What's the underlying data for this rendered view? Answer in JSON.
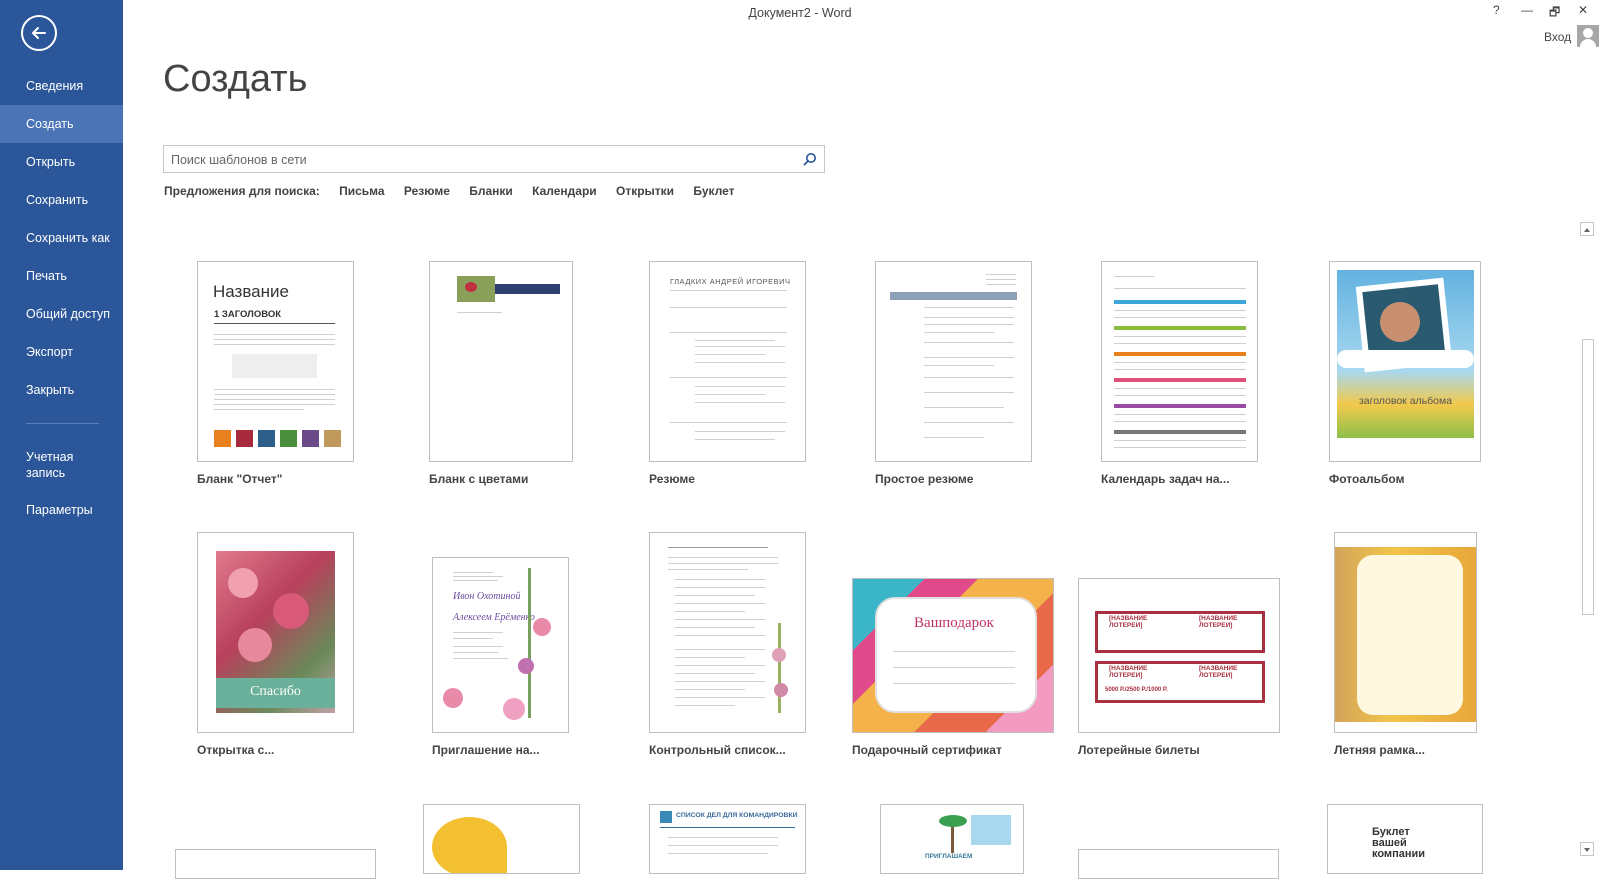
{
  "window": {
    "title": "Документ2 - Word",
    "help": "?",
    "minimize": "—",
    "restore": "🗗",
    "close": "✕",
    "sign_in": "Вход"
  },
  "sidebar": {
    "items": [
      "Сведения",
      "Создать",
      "Открыть",
      "Сохранить",
      "Сохранить как",
      "Печать",
      "Общий доступ",
      "Экспорт",
      "Закрыть",
      "Учетная запись",
      "Параметры"
    ],
    "active": "Создать"
  },
  "main": {
    "heading": "Создать",
    "search_placeholder": "Поиск шаблонов в сети",
    "suggest_label": "Предложения для поиска:",
    "suggestions": [
      "Письма",
      "Резюме",
      "Бланки",
      "Календари",
      "Открытки",
      "Буклет"
    ]
  },
  "templates": [
    {
      "caption": "Бланк \"Отчет\"",
      "title": "Название",
      "heading": "1  ЗАГОЛОВОК"
    },
    {
      "caption": "Бланк с цветами"
    },
    {
      "caption": "Резюме",
      "name": "ГЛАДКИХ АНДРЕЙ ИГОРЕВИЧ"
    },
    {
      "caption": "Простое резюме"
    },
    {
      "caption": "Календарь задач на..."
    },
    {
      "caption": "Фотоальбом",
      "album": "заголовок альбома"
    },
    {
      "caption": "Открытка с...",
      "card": "Спасибо"
    },
    {
      "caption": "Приглашение на...",
      "name1": "Ивон Охотиной",
      "name2": "Алексеем Ерёменко"
    },
    {
      "caption": "Контрольный список..."
    },
    {
      "caption": "Подарочный сертификат",
      "gift": "Вашподарок"
    },
    {
      "caption": "Лотерейные билеты",
      "ticket": "[НАЗВАНИЕ ЛОТЕРЕИ]",
      "prize": "5000 Р./2500 Р./1000 Р."
    },
    {
      "caption": "Летняя рамка..."
    },
    {
      "banner": "СПИСОК ДЕЛ ДЛЯ КОМАНДИРОВКИ"
    },
    {
      "invite": "ПРИГЛАШАЕМ"
    },
    {
      "booklet": "Буклет вашей компании"
    }
  ],
  "colors": {
    "sidebar": "#2b579a",
    "sidebar_active": "#4a74b6",
    "swatches": [
      "#e8801e",
      "#a72b3c",
      "#2d5f8a",
      "#4a8f3c",
      "#6b4a8a",
      "#c09a5c"
    ]
  }
}
